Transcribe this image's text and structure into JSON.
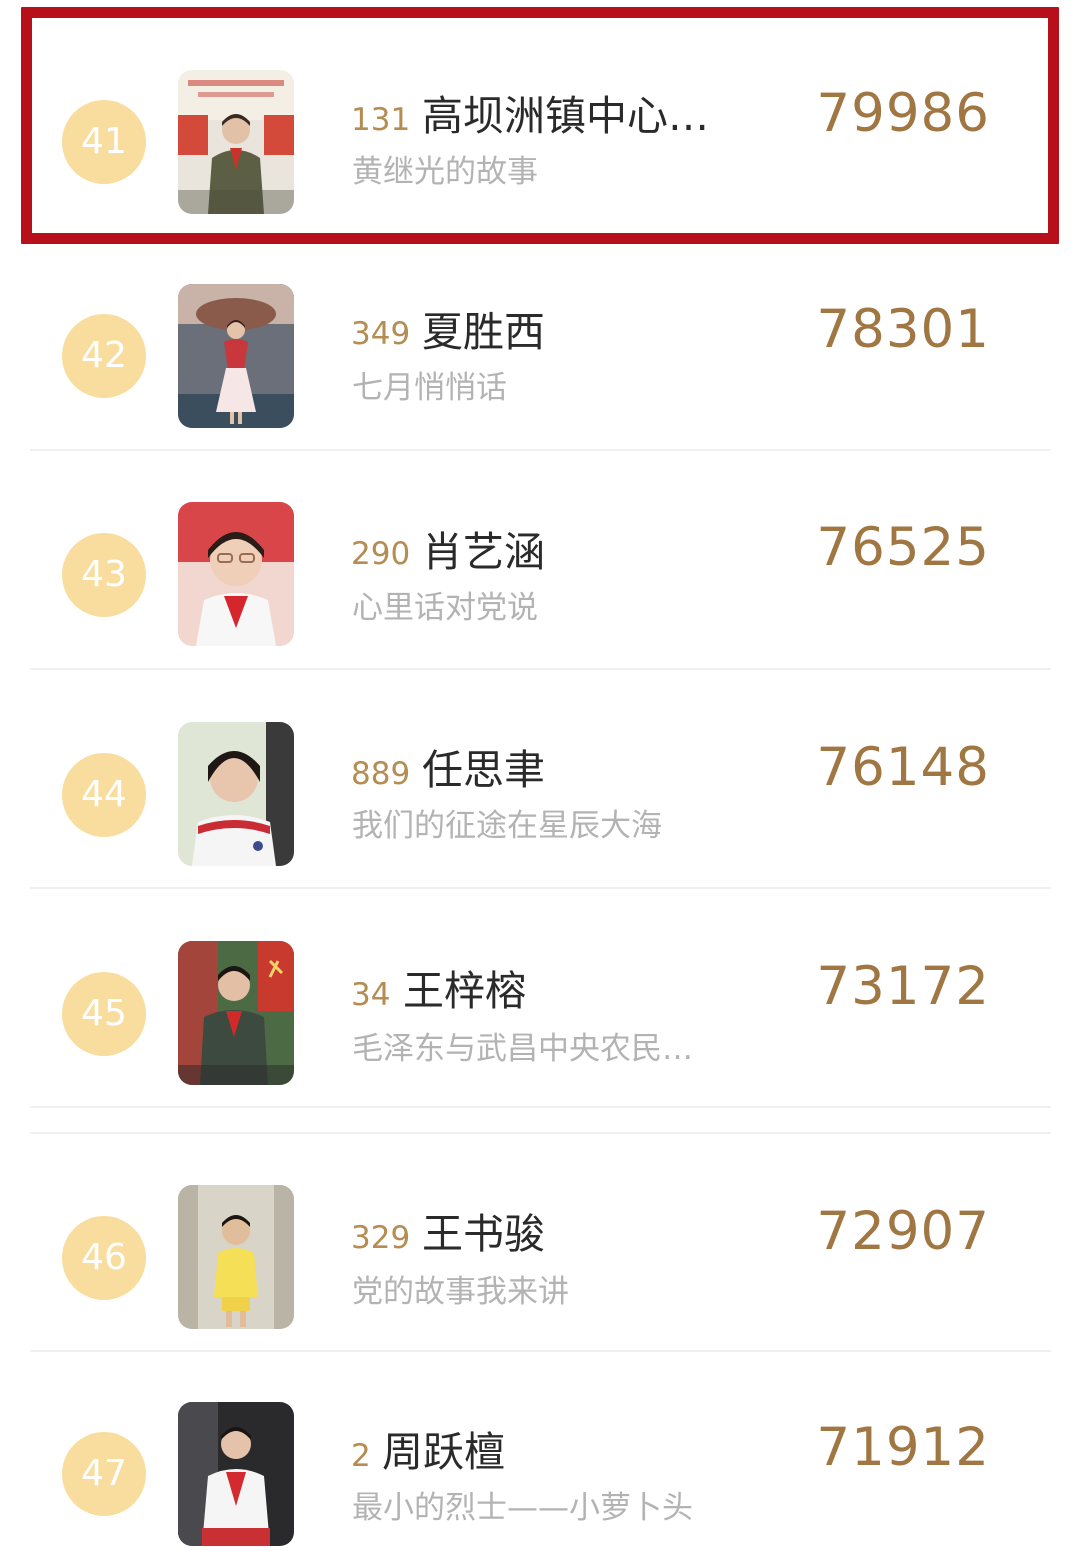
{
  "ranking": {
    "rows": [
      {
        "rank": "41",
        "entry_no": "131",
        "name": "高坝洲镇中心…",
        "title": "黄继光的故事",
        "votes": "79986",
        "highlighted": true
      },
      {
        "rank": "42",
        "entry_no": "349",
        "name": "夏胜西",
        "title": "七月悄悄话",
        "votes": "78301",
        "highlighted": false
      },
      {
        "rank": "43",
        "entry_no": "290",
        "name": "肖艺涵",
        "title": "心里话对党说",
        "votes": "76525",
        "highlighted": false
      },
      {
        "rank": "44",
        "entry_no": "889",
        "name": "任思聿",
        "title": "我们的征途在星辰大海",
        "votes": "76148",
        "highlighted": false
      },
      {
        "rank": "45",
        "entry_no": "34",
        "name": "王梓榕",
        "title": "毛泽东与武昌中央农民…",
        "votes": "73172",
        "highlighted": false
      },
      {
        "rank": "46",
        "entry_no": "329",
        "name": "王书骏",
        "title": "党的故事我来讲",
        "votes": "72907",
        "highlighted": false
      },
      {
        "rank": "47",
        "entry_no": "2",
        "name": "周跃檀",
        "title": "最小的烈士——小萝卜头",
        "votes": "71912",
        "highlighted": false
      }
    ]
  },
  "colors": {
    "badge": "#f8dd9e",
    "entry_no": "#b58c52",
    "votes": "#a07642",
    "highlight_border": "#b8101a"
  }
}
